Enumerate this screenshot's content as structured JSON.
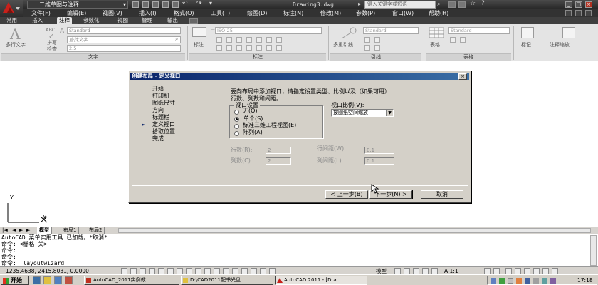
{
  "titlebar": {
    "workspace": "二维草图与注释",
    "document_title": "Drawing3.dwg",
    "search_placeholder": "键入关键字或短语",
    "min": "_",
    "max": "□",
    "close": "×"
  },
  "menus": [
    "文件(F)",
    "编辑(E)",
    "视图(V)",
    "插入(I)",
    "格式(O)",
    "工具(T)",
    "绘图(D)",
    "标注(N)",
    "修改(M)",
    "参数(P)",
    "窗口(W)",
    "帮助(H)"
  ],
  "ribbon_tabs": [
    "常用",
    "插入",
    "注释",
    "参数化",
    "视图",
    "管理",
    "输出"
  ],
  "ribbon": {
    "text_panel_title": "文字",
    "multiline_text": "多行文字",
    "spell_check": "拼写\n检查",
    "abc": "ABC",
    "text_style": "Standard",
    "find_text": "查找文字",
    "text_height": "2.5",
    "dim_panel_title": "标注",
    "dim_label": "标注",
    "dim_style": "ISO-25",
    "leader_panel_title": "引线",
    "multileader": "多重引线",
    "leader_style": "Standard",
    "table_panel_title": "表格",
    "table_label": "表格",
    "table_style": "Standard",
    "markup_label": "标记",
    "annoscale_label": "注释缩放"
  },
  "ucs": {
    "y": "Y",
    "x": "X"
  },
  "layout_tabs": [
    "模型",
    "布局1",
    "布局2"
  ],
  "command_lines": [
    "AutoCAD 菜单实用工具 已加载。*取消*",
    "命令: <栅格 关>",
    "命令:",
    "命令:",
    "命令: _layoutwizard"
  ],
  "status": {
    "coords": "1235.4638, 2415.8031, 0.0000",
    "model": "模型",
    "scale": "A 1:1"
  },
  "dialog": {
    "title": "创建布局 - 定义视口",
    "close": "×",
    "steps": [
      "开始",
      "打印机",
      "图纸尺寸",
      "方向",
      "标题栏",
      "定义视口",
      "拾取位置",
      "完成"
    ],
    "active_step_index": 5,
    "current_marker": "►",
    "description": "要向布局中添加视口，请指定设置类型、比例以及（如果可用）行数、列数和间距。",
    "viewport_setup_legend": "视口设置",
    "radios": [
      "无(O)",
      "单个(S)",
      "标准三维工程视图(E)",
      "阵列(A)"
    ],
    "selected_radio": 1,
    "viewport_scale_label": "视口比例(V):",
    "viewport_scale_value": "按图纸空间缩放",
    "rows_label": "行数(R):",
    "rows_value": "2",
    "cols_label": "列数(C):",
    "cols_value": "2",
    "row_spacing_label": "行间距(W):",
    "row_spacing_value": "0.1",
    "col_spacing_label": "列间距(L):",
    "col_spacing_value": "0.1",
    "back_button": "< 上一步(B)",
    "next_button": "下一步(N) >",
    "cancel_button": "取消"
  },
  "taskbar": {
    "start": "开始",
    "items": [
      "AutoCAD_2011实例教...",
      "D:\\CAD2011配书光盘",
      "AutoCAD 2011 - [Dra..."
    ],
    "active_index": 2,
    "clock": "17:18"
  },
  "colors": {
    "dialog_title_start": "#0a246a",
    "dialog_title_end": "#3a6ea5",
    "app_logo_red": "#c8211b",
    "ribbon_bg": "#e4e4e4"
  }
}
